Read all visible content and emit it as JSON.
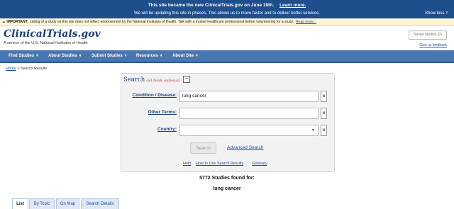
{
  "banner": {
    "line1": "This site became the new ClinicalTrials.gov on June 19th.",
    "learn_more": "Learn more.",
    "line2": "We will be updating this site in phases. This allows us to move faster and to deliver better services.",
    "show_less": "Show less"
  },
  "notice": {
    "label": "IMPORTANT:",
    "text": "Listing of a study on this site does not reflect endorsement by the National Institutes of Health. Talk with a trusted healthcare professional before volunteering for a study.",
    "read_more": "Read more..."
  },
  "header": {
    "logo": "ClinicalTrials.gov",
    "tagline": "A service of the U.S. National Institutes of Health",
    "saved_studies": "Saved Studies (0)",
    "feedback": "Give us feedback"
  },
  "nav": {
    "items": [
      "Find Studies",
      "About Studies",
      "Submit Studies",
      "Resources",
      "About Site"
    ]
  },
  "breadcrumb": {
    "home": "Home",
    "sep": ">",
    "current": "Search Results"
  },
  "search": {
    "title": "Search",
    "optional": "(all fields optional)",
    "condition_label": "Condition / Disease:",
    "condition_value": "lung cancer",
    "other_terms_label": "Other Terms:",
    "other_terms_value": "",
    "country_label": "Country:",
    "country_value": "",
    "clear": "x",
    "search_button": "Search",
    "advanced_search": "Advanced Search",
    "help": "Help",
    "how_to": "How to Use Search Results",
    "glossary": "Glossary"
  },
  "results": {
    "count_text": "5772 Studies found for:",
    "query": "lung cancer"
  },
  "tabs": [
    "List",
    "By Topic",
    "On Map",
    "Search Details"
  ]
}
